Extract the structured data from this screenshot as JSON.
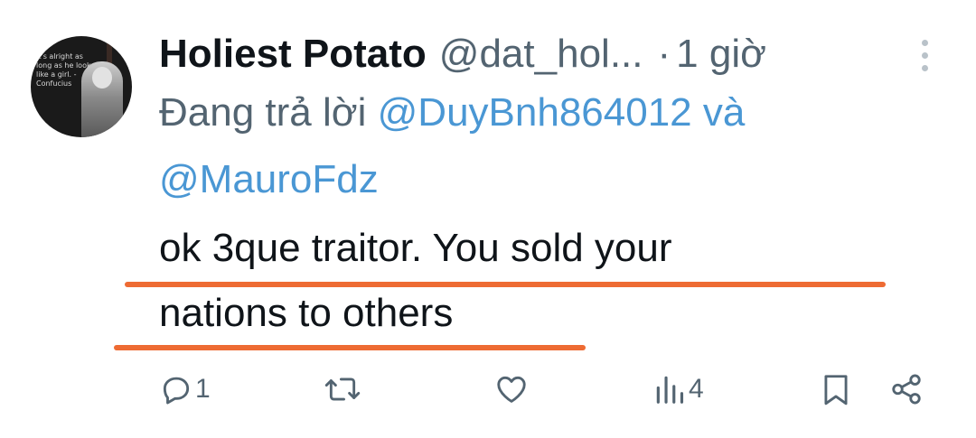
{
  "tweet": {
    "author_name": "Holiest Potato",
    "author_handle": "@dat_hol...",
    "separator": "·",
    "time_ago": "1 giờ",
    "reply_prefix": "Đang trả lời",
    "reply_mention_1": "@DuyBnh864012",
    "reply_conjunction": "và",
    "reply_mention_2": "@MauroFdz",
    "text_line_1": "ok 3que traitor. You sold your",
    "text_line_2": "nations to others"
  },
  "avatar": {
    "quote_text": "It's alright as long as he looks like a girl. - Confucius"
  },
  "actions": {
    "reply_count": "1",
    "repost_count": "",
    "like_count": "",
    "views_count": "4"
  },
  "icons": {
    "reply": "reply-icon",
    "repost": "repost-icon",
    "like": "heart-icon",
    "views": "views-icon",
    "bookmark": "bookmark-icon",
    "share": "share-icon",
    "more": "more-icon"
  },
  "colors": {
    "mention": "#4a97d4",
    "secondary_text": "#536471",
    "primary_text": "#0f1419",
    "annotation_underline": "#ee6b33"
  }
}
